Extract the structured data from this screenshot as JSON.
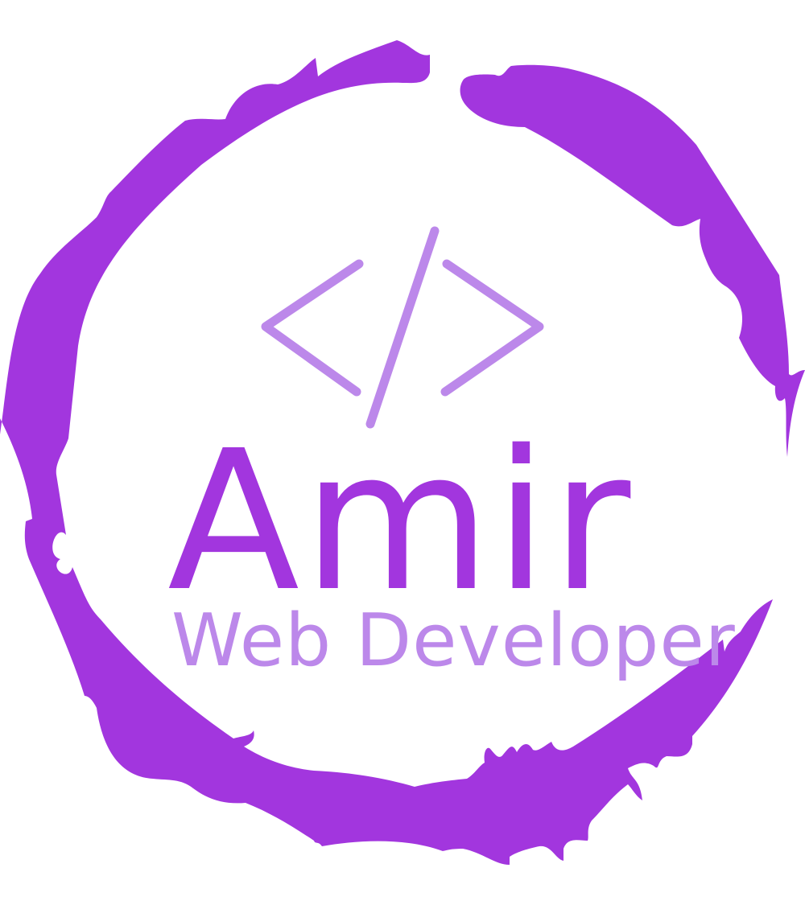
{
  "logo": {
    "name": "Amir",
    "subtitle": "Web Developer",
    "icon": "code-brackets-icon",
    "decoration": "brush-stroke-ring"
  },
  "colors": {
    "ring": "#A236DE",
    "name": "#A236DE",
    "subtitle": "#BC88EA",
    "icon": "#BC88EA",
    "background": "#FFFFFF"
  }
}
